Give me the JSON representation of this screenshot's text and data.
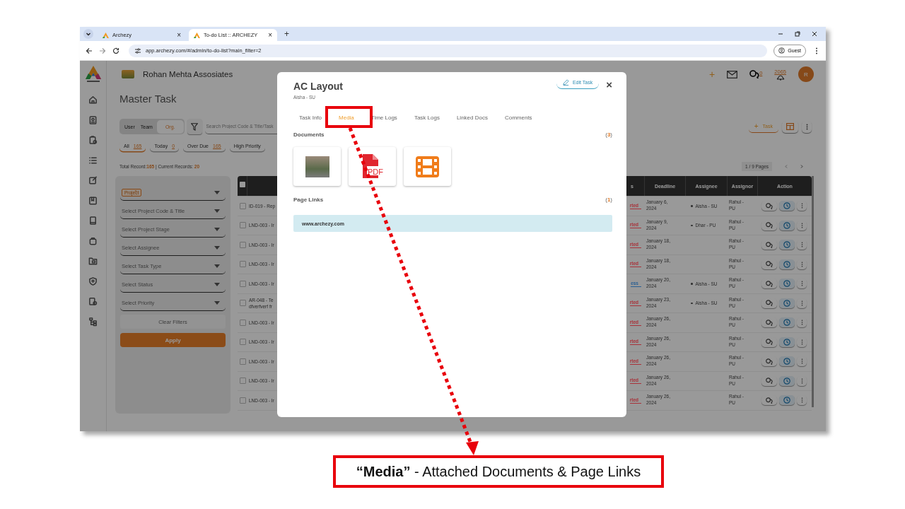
{
  "browser": {
    "tabs": [
      {
        "title": "Archezy",
        "close": "×",
        "selected": false
      },
      {
        "title": "To-do List :: ARCHEZY",
        "close": "×",
        "selected": true
      }
    ],
    "new_tab": "+",
    "url": "app.archezy.com/#/admin/to-do-list?main_filter=2",
    "profile": "Guest"
  },
  "app": {
    "company": "Rohan Mehta Assosiates",
    "page_title": "Master Task",
    "header": {
      "add": "+",
      "chat_count": "0",
      "notification_count": "2065",
      "avatar": "R"
    },
    "scope_toggle": [
      {
        "label": "User",
        "selected": false
      },
      {
        "label": "Team",
        "selected": false
      },
      {
        "label": "Org.",
        "selected": true
      }
    ],
    "search": {
      "placeholder": "Search Project Code & Title/Task"
    },
    "quick_filters": [
      {
        "label": "All",
        "count": "165",
        "selected": true
      },
      {
        "label": "Today",
        "count": "0",
        "selected": false
      },
      {
        "label": "Over Due",
        "count": "165",
        "selected": false
      },
      {
        "label": "High Priority",
        "selected": false
      }
    ],
    "summary": {
      "total_label": "Total Record:",
      "total": "165",
      "current_label": " | Current Records: ",
      "current": "20"
    },
    "add_task": {
      "icon": "+",
      "label": "Task"
    },
    "pagination": "1 / 9 Pages",
    "filters": {
      "selects": [
        {
          "kind": "chip",
          "value": "Project",
          "remove": "×"
        },
        {
          "kind": "empty",
          "placeholder": "Select Project Code & Title"
        },
        {
          "kind": "empty",
          "placeholder": "Select Project Stage"
        },
        {
          "kind": "empty",
          "placeholder": "Select Assignee"
        },
        {
          "kind": "empty",
          "placeholder": "Select Task Type"
        },
        {
          "kind": "empty",
          "placeholder": "Select Status"
        },
        {
          "kind": "empty",
          "placeholder": "Select Priority"
        }
      ],
      "clear": "Clear Filters",
      "apply": "Apply"
    },
    "table": {
      "select_all": {
        "selected": false
      },
      "columns": [
        "s",
        "Deadline",
        "Assignee",
        "Assignor",
        "Action"
      ],
      "rows": [
        {
          "selected": false,
          "task": "ID-019 - Rep",
          "status": "rted",
          "color": "#a8323a",
          "deadline": "January 6, 2024",
          "assignee": "Aisha - SU",
          "assignor": "Rahul - PU"
        },
        {
          "selected": false,
          "task": "LND-003 - Ir",
          "status": "rted",
          "color": "#a8323a",
          "deadline": "January 9, 2024",
          "assignee": "Dhar - PU",
          "assignor": "Rahul - PU"
        },
        {
          "selected": false,
          "task": "LND-003 - Ir",
          "status": "rted",
          "color": "#a8323a",
          "deadline": "January 18, 2024",
          "assignor": "Rahul - PU"
        },
        {
          "selected": false,
          "task": "LND-003 - Ir",
          "status": "rted",
          "color": "#a8323a",
          "deadline": "January 18, 2024",
          "assignor": "Rahul - PU"
        },
        {
          "selected": false,
          "task": "LND-003 - Ir",
          "status": "ess",
          "color": "#2a5f93",
          "deadline": "January 20, 2024",
          "assignee": "Aisha - SU",
          "assignor": "Rahul - PU"
        },
        {
          "selected": false,
          "task": "AR-048 - Te\ndfverfverf fr",
          "status": "rted",
          "color": "#a8323a",
          "deadline": "January 23, 2024",
          "assignee": "Aisha - SU",
          "assignor": "Rahul - PU"
        },
        {
          "selected": false,
          "task": "LND-003 - Ir",
          "status": "rted",
          "color": "#a8323a",
          "deadline": "January 26, 2024",
          "assignor": "Rahul - PU"
        },
        {
          "selected": false,
          "task": "LND-003 - Ir",
          "status": "rted",
          "color": "#a8323a",
          "deadline": "January 26, 2024",
          "assignor": "Rahul - PU"
        },
        {
          "selected": false,
          "task": "LND-003 - Ir",
          "status": "rted",
          "color": "#a8323a",
          "deadline": "January 26, 2024",
          "assignor": "Rahul - PU"
        },
        {
          "selected": false,
          "task": "LND-003 - Ir",
          "status": "rted",
          "color": "#a8323a",
          "deadline": "January 26, 2024",
          "assignor": "Rahul - PU"
        },
        {
          "selected": false,
          "task": "LND-003 - Ir",
          "status": "rted",
          "color": "#a8323a",
          "deadline": "January 26, 2024",
          "assignor": "Rahul - PU"
        }
      ]
    }
  },
  "modal": {
    "title": "AC Layout",
    "subtitle": "Aisha - SU",
    "edit_button": "Edit Task",
    "close": "×",
    "tabs": [
      {
        "label": "Task Info",
        "selected": false
      },
      {
        "label": "Media",
        "selected": true
      },
      {
        "label": "Time Logs",
        "selected": false
      },
      {
        "label": "Task Logs",
        "selected": false
      },
      {
        "label": "Linked Docs",
        "selected": false
      },
      {
        "label": "Comments",
        "selected": false
      }
    ],
    "documents": {
      "title": "Documents",
      "count": {
        "open": "(",
        "value": "3",
        "close": ")"
      },
      "items": [
        {
          "kind": "image"
        },
        {
          "kind": "pdf",
          "label": "PDF"
        },
        {
          "kind": "video"
        }
      ]
    },
    "page_links": {
      "title": "Page Links",
      "count": {
        "open": "(",
        "value": "1",
        "close": ")"
      },
      "links": [
        "www.archezy.com"
      ]
    }
  },
  "callout": "**“Media”** - Attached Documents & Page Links"
}
